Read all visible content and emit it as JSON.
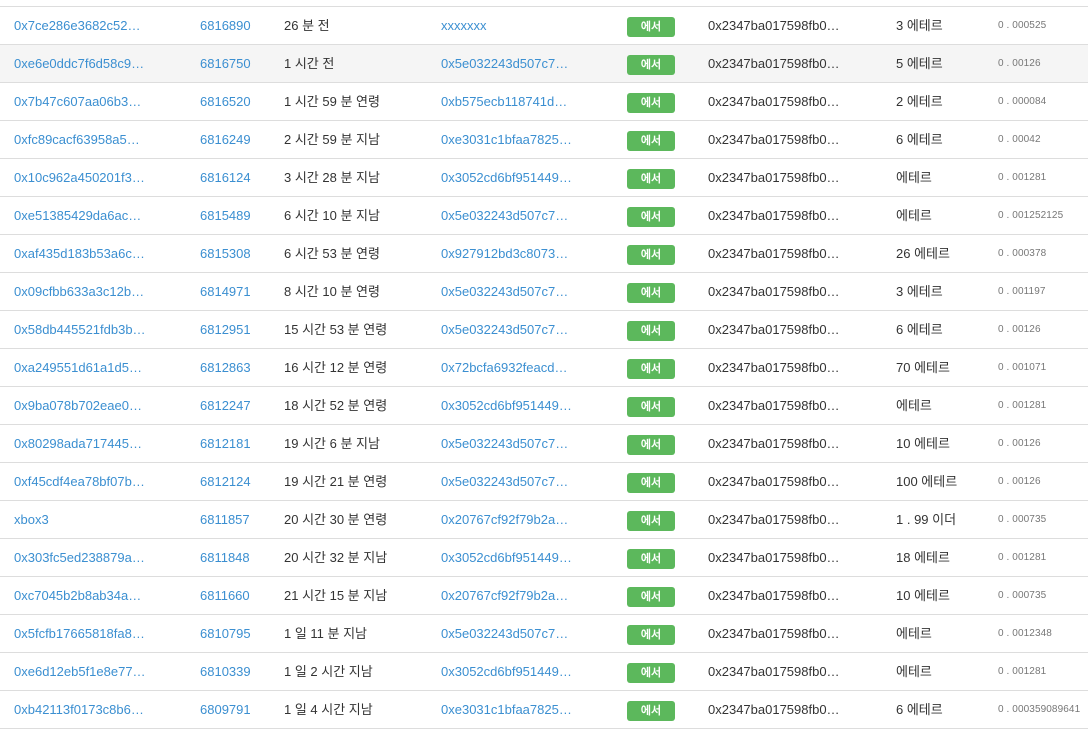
{
  "colors": {
    "link": "#3b8fd1",
    "badge_bg": "#5cb85c",
    "row_stripe": "#f5f5f5",
    "divider": "#dddddd"
  },
  "rows": [
    {
      "hash": "0x7ce286e3682c52…",
      "block": "6816890",
      "age": "26 분 전",
      "from": "xxxxxxx",
      "direction": "에서",
      "to": "0x2347ba017598fb0…",
      "value": "3 에테르",
      "fee": "0 . 000525"
    },
    {
      "hash": "0xe6e0ddc7f6d58c9…",
      "block": "6816750",
      "age": "1 시간 전",
      "from": "0x5e032243d507c7…",
      "direction": "에서",
      "to": "0x2347ba017598fb0…",
      "value": "5 에테르",
      "fee": "0 . 00126"
    },
    {
      "hash": "0x7b47c607aa06b3…",
      "block": "6816520",
      "age": "1 시간 59 분 연령",
      "from": "0xb575ecb118741d…",
      "direction": "에서",
      "to": "0x2347ba017598fb0…",
      "value": "2 에테르",
      "fee": "0 . 000084"
    },
    {
      "hash": "0xfc89cacf63958a5…",
      "block": "6816249",
      "age": "2 시간 59 분 지남",
      "from": "0xe3031c1bfaa7825…",
      "direction": "에서",
      "to": "0x2347ba017598fb0…",
      "value": "6 에테르",
      "fee": "0 . 00042"
    },
    {
      "hash": "0x10c962a450201f3…",
      "block": "6816124",
      "age": "3 시간 28 분 지남",
      "from": "0x3052cd6bf951449…",
      "direction": "에서",
      "to": "0x2347ba017598fb0…",
      "value": "에테르",
      "fee": "0 . 001281"
    },
    {
      "hash": "0xe51385429da6ac…",
      "block": "6815489",
      "age": "6 시간 10 분 지남",
      "from": "0x5e032243d507c7…",
      "direction": "에서",
      "to": "0x2347ba017598fb0…",
      "value": "에테르",
      "fee": "0 . 001252125"
    },
    {
      "hash": "0xaf435d183b53a6c…",
      "block": "6815308",
      "age": "6 시간 53 분 연령",
      "from": "0x927912bd3c8073…",
      "direction": "에서",
      "to": "0x2347ba017598fb0…",
      "value": "26 에테르",
      "fee": "0 . 000378"
    },
    {
      "hash": "0x09cfbb633a3c12b…",
      "block": "6814971",
      "age": "8 시간 10 분 연령",
      "from": "0x5e032243d507c7…",
      "direction": "에서",
      "to": "0x2347ba017598fb0…",
      "value": "3 에테르",
      "fee": "0 . 001197"
    },
    {
      "hash": "0x58db445521fdb3b…",
      "block": "6812951",
      "age": "15 시간 53 분 연령",
      "from": "0x5e032243d507c7…",
      "direction": "에서",
      "to": "0x2347ba017598fb0…",
      "value": "6 에테르",
      "fee": "0 . 00126"
    },
    {
      "hash": "0xa249551d61a1d5…",
      "block": "6812863",
      "age": "16 시간 12 분 연령",
      "from": "0x72bcfa6932feacd…",
      "direction": "에서",
      "to": "0x2347ba017598fb0…",
      "value": "70 에테르",
      "fee": "0 . 001071"
    },
    {
      "hash": "0x9ba078b702eae0…",
      "block": "6812247",
      "age": "18 시간 52 분 연령",
      "from": "0x3052cd6bf951449…",
      "direction": "에서",
      "to": "0x2347ba017598fb0…",
      "value": "에테르",
      "fee": "0 . 001281"
    },
    {
      "hash": "0x80298ada717445…",
      "block": "6812181",
      "age": "19 시간 6 분 지남",
      "from": "0x5e032243d507c7…",
      "direction": "에서",
      "to": "0x2347ba017598fb0…",
      "value": "10 에테르",
      "fee": "0 . 00126"
    },
    {
      "hash": "0xf45cdf4ea78bf07b…",
      "block": "6812124",
      "age": "19 시간 21 분 연령",
      "from": "0x5e032243d507c7…",
      "direction": "에서",
      "to": "0x2347ba017598fb0…",
      "value": "100 에테르",
      "fee": "0 . 00126"
    },
    {
      "hash": "xbox3",
      "block": "6811857",
      "age": "20 시간 30 분 연령",
      "from": "0x20767cf92f79b2a…",
      "direction": "에서",
      "to": "0x2347ba017598fb0…",
      "value": "1 . 99 이더",
      "fee": "0 . 000735"
    },
    {
      "hash": "0x303fc5ed238879a…",
      "block": "6811848",
      "age": "20 시간 32 분 지남",
      "from": "0x3052cd6bf951449…",
      "direction": "에서",
      "to": "0x2347ba017598fb0…",
      "value": "18 에테르",
      "fee": "0 . 001281"
    },
    {
      "hash": "0xc7045b2b8ab34a…",
      "block": "6811660",
      "age": "21 시간 15 분 지남",
      "from": "0x20767cf92f79b2a…",
      "direction": "에서",
      "to": "0x2347ba017598fb0…",
      "value": "10 에테르",
      "fee": "0 . 000735"
    },
    {
      "hash": "0x5fcfb17665818fa8…",
      "block": "6810795",
      "age": "1 일 11 분 지남",
      "from": "0x5e032243d507c7…",
      "direction": "에서",
      "to": "0x2347ba017598fb0…",
      "value": "에테르",
      "fee": "0 . 0012348"
    },
    {
      "hash": "0xe6d12eb5f1e8e77…",
      "block": "6810339",
      "age": "1 일 2 시간 지남",
      "from": "0x3052cd6bf951449…",
      "direction": "에서",
      "to": "0x2347ba017598fb0…",
      "value": "에테르",
      "fee": "0 . 001281"
    },
    {
      "hash": "0xb42113f0173c8b6…",
      "block": "6809791",
      "age": "1 일 4 시간 지남",
      "from": "0xe3031c1bfaa7825…",
      "direction": "에서",
      "to": "0x2347ba017598fb0…",
      "value": "6 에테르",
      "fee": "0 . 000359089641"
    }
  ]
}
